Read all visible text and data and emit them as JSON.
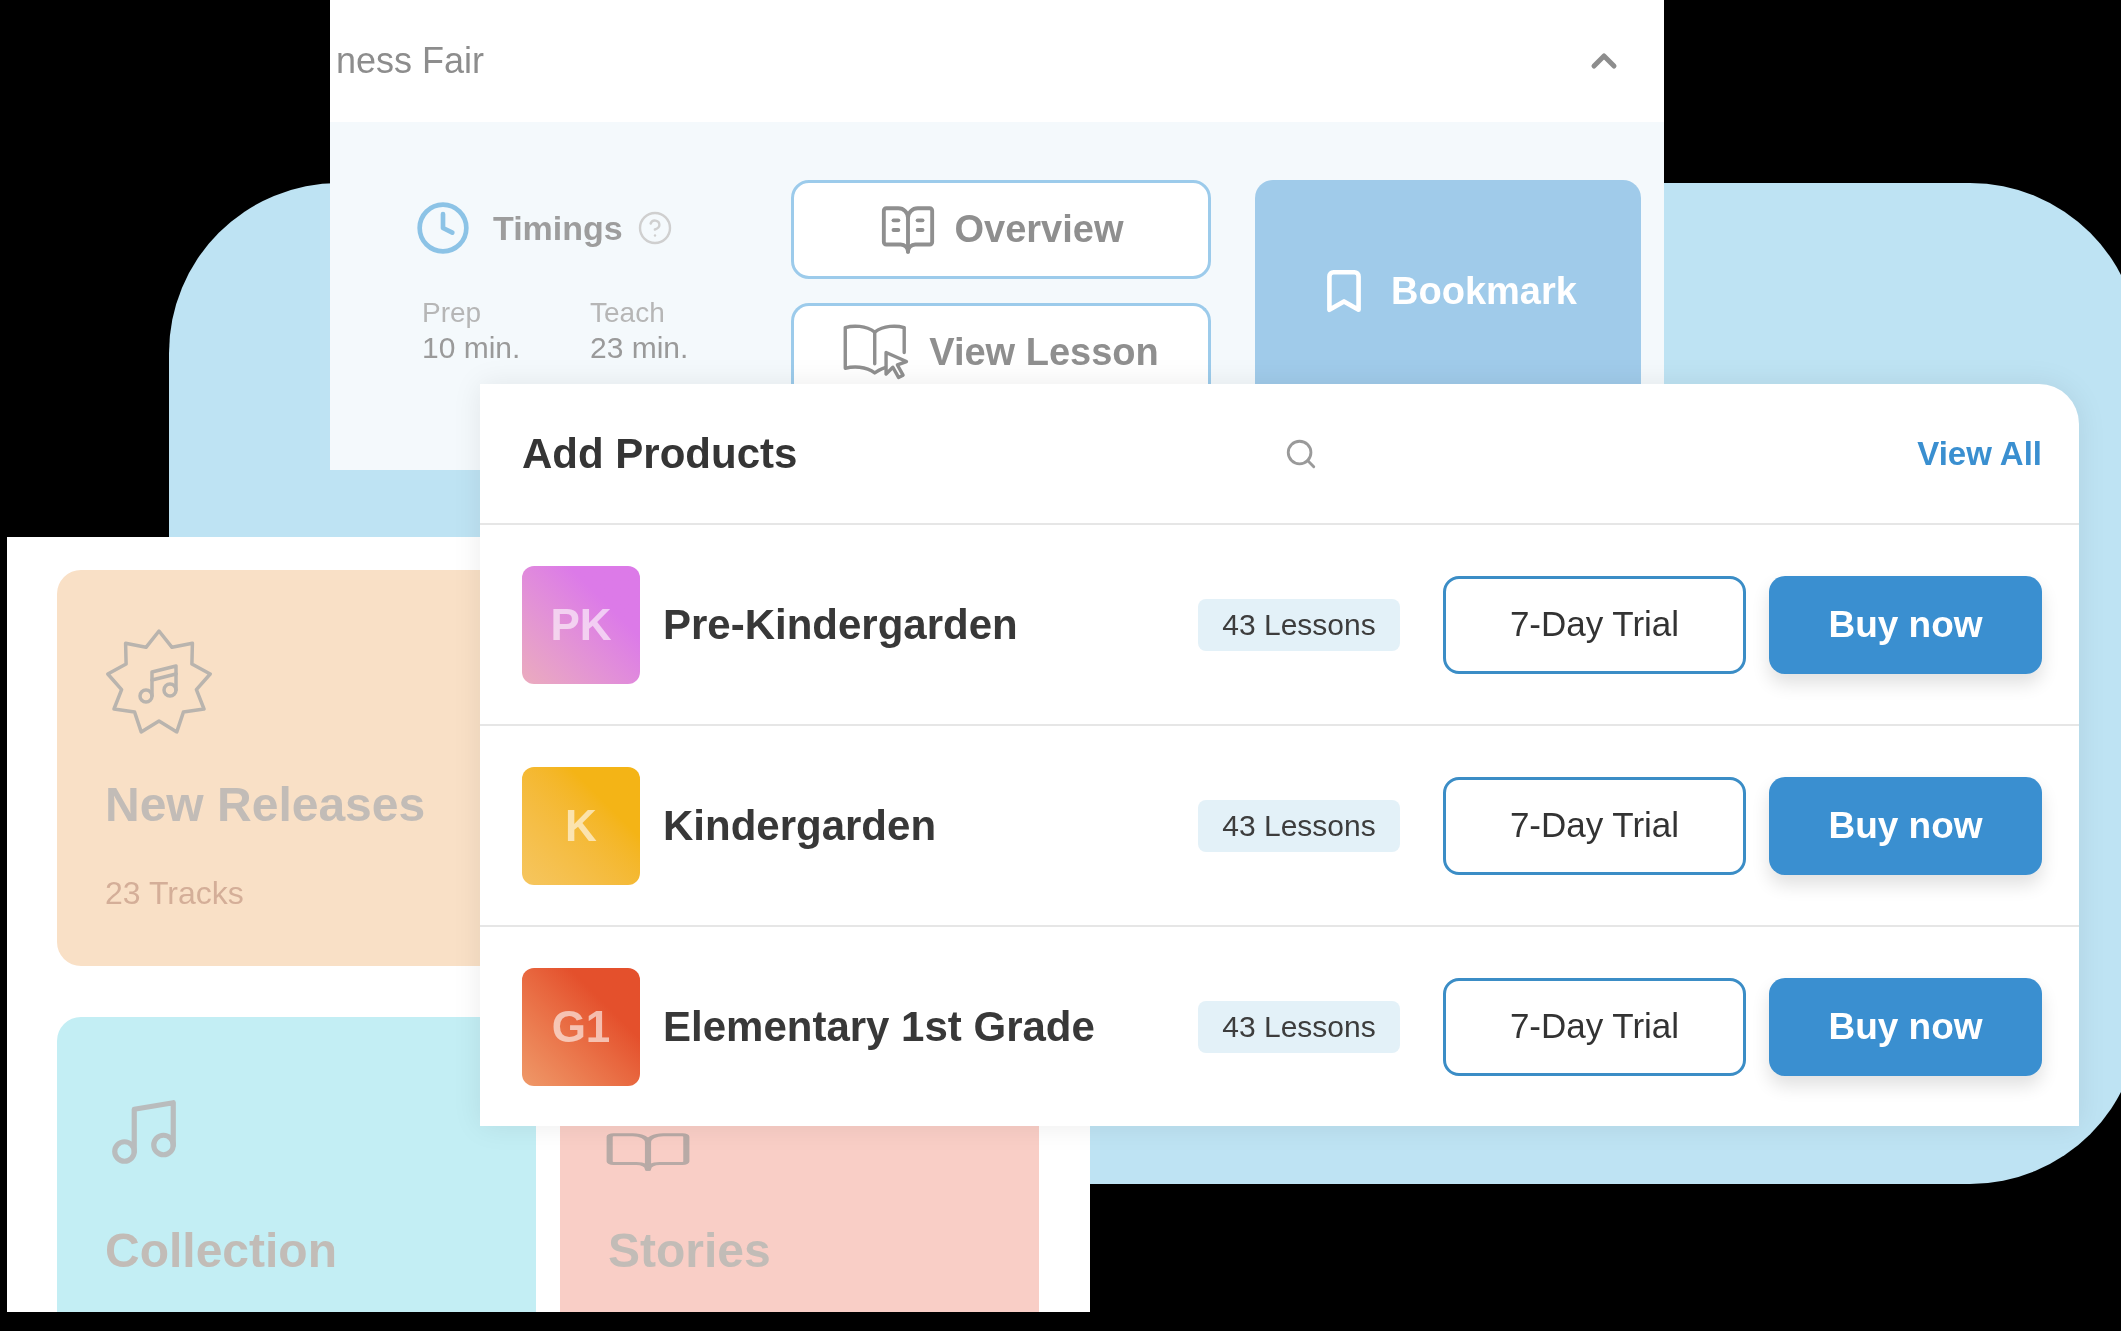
{
  "lesson_card": {
    "title": "ness Fair",
    "expanded": true,
    "timings": {
      "label": "Timings",
      "items": [
        {
          "label": "Prep",
          "value": "10 min."
        },
        {
          "label": "Teach",
          "value": "23 min."
        }
      ]
    },
    "buttons": [
      {
        "label": "Overview",
        "kind": "outline"
      },
      {
        "label": "View Lesson",
        "kind": "outline"
      },
      {
        "label": "Bookmark",
        "kind": "filled"
      }
    ]
  },
  "products_panel": {
    "title": "Add Products",
    "link": "View All",
    "rows": [
      {
        "code": "PK",
        "name": "Pre-Kindergarden",
        "lessons": "43 Lessons",
        "trial_button": "7-Day Trial",
        "buy_button": "Buy now",
        "color": "#dc7ae8"
      },
      {
        "code": "K",
        "name": "Kindergarden",
        "lessons": "43 Lessons",
        "trial_button": "7-Day Trial",
        "buy_button": "Buy now",
        "color": "#f4b416"
      },
      {
        "code": "G1",
        "name": "Elementary 1st Grade",
        "lessons": "43 Lessons",
        "trial_button": "7-Day Trial",
        "buy_button": "Buy now",
        "color": "#e4502c"
      }
    ]
  },
  "categories": [
    {
      "title": "New Releases",
      "subtitle": "23 Tracks",
      "color": "#f9e0c6"
    },
    {
      "title": "Collection",
      "color": "#c3eef4"
    },
    {
      "title": "Stories",
      "color": "#f9cec6"
    }
  ]
}
